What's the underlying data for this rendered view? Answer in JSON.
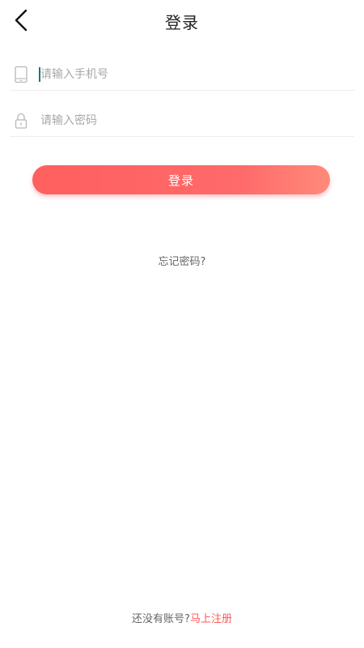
{
  "header": {
    "back_icon": "chevron-left-icon",
    "title": "登录"
  },
  "form": {
    "phone": {
      "icon": "phone-icon",
      "placeholder": "请输入手机号",
      "value": ""
    },
    "password": {
      "icon": "lock-icon",
      "placeholder": "请输入密码",
      "value": ""
    },
    "login_label": "登录"
  },
  "forgot_password": "忘记密码?",
  "footer": {
    "prompt": "还没有账号?",
    "register_label": "马上注册"
  },
  "colors": {
    "accent": "#ff5f5f",
    "link": "#ff5a5a",
    "caret": "#1a7a6e"
  }
}
